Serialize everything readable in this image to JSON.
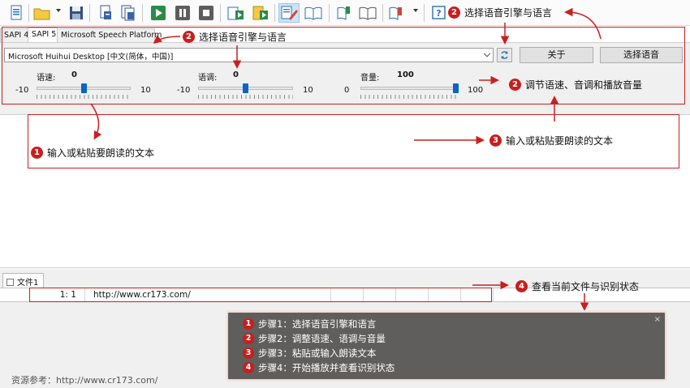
{
  "tabs": [
    "SAPI 4",
    "SAPI 5",
    "Microsoft Speech Platform"
  ],
  "voice_select": {
    "value": "Microsoft Huihui Desktop [中文(简体，中国)]"
  },
  "buttons": {
    "about": "关于",
    "select_voice": "选择语音"
  },
  "sliders": {
    "rate": {
      "label": "语速:",
      "value": "0",
      "min": "-10",
      "max": "10",
      "level": 0.5
    },
    "pitch": {
      "label": "语调:",
      "value": "0",
      "min": "-10",
      "max": "10",
      "level": 0.5
    },
    "volume": {
      "label": "音量:",
      "value": "100",
      "min": "0",
      "max": "100",
      "level": 1.0
    }
  },
  "document_tab": "文件1",
  "status_bar": {
    "position": "1:  1",
    "url": "http://www.cr173.com/"
  },
  "annotations": {
    "a1": {
      "num": "1",
      "text": "输入或粘贴要朗读的文本"
    },
    "a2_toolbar": {
      "num": "2",
      "text": "选择语音引擎与语言"
    },
    "a2_panel": {
      "num": "2",
      "text": "选择语音引擎与语言"
    },
    "a2_sliders": {
      "num": "2",
      "text": "调节语速、音调和播放音量"
    },
    "a3": {
      "num": "3",
      "text": "输入或粘贴要朗读的文本"
    },
    "a4": {
      "num": "4",
      "text": "查看当前文件与识别状态"
    }
  },
  "steps": [
    {
      "num": "1",
      "text": "步骤1：选择语音引擎和语言"
    },
    {
      "num": "2",
      "text": "步骤2：调整语速、语调与音量"
    },
    {
      "num": "3",
      "text": "步骤3：粘贴或输入朗读文本"
    },
    {
      "num": "4",
      "text": "步骤4：开始播放并查看识别状态"
    }
  ],
  "steps_close": "×",
  "footer": "资源参考：http://www.cr173.com/",
  "colors": {
    "annotation_red": "#c92020",
    "slider_thumb": "#0a64c8",
    "panel_bg": "#f0f0f0",
    "steps_bg": "#5f5e5c"
  },
  "icons": [
    "new-document-icon",
    "open-folder-icon",
    "save-icon",
    "export-document-icon",
    "export-all-icon",
    "play-icon",
    "pause-icon",
    "stop-icon",
    "speak-to-file-icon",
    "speak-clipboard-icon",
    "edit-text-icon",
    "read-book-icon",
    "add-bookmark-icon",
    "bookmarks-icon",
    "bookmark-menu-icon",
    "help-icon",
    "refresh-icon"
  ]
}
